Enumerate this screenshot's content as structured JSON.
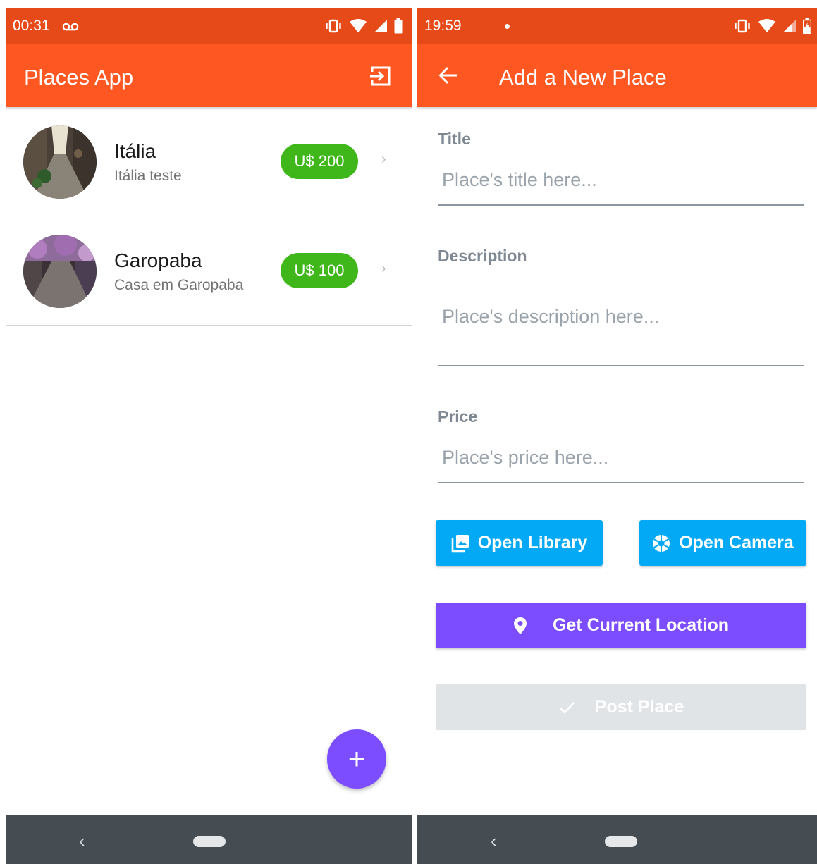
{
  "left_screen": {
    "status": {
      "time": "00:31"
    },
    "appbar": {
      "title": "Places App",
      "logout_icon": "logout-icon"
    },
    "places": [
      {
        "title": "Itália",
        "subtitle": "Itália teste",
        "price": "U$ 200"
      },
      {
        "title": "Garopaba",
        "subtitle": "Casa em Garopaba",
        "price": "U$ 100"
      }
    ],
    "fab": {
      "label": "+"
    },
    "colors": {
      "status": "#e64a19",
      "appbar": "#ff5722",
      "badge": "#3fb71a",
      "fab": "#7c4dff"
    }
  },
  "right_screen": {
    "status": {
      "time": "19:59"
    },
    "appbar": {
      "title": "Add a New Place",
      "back_icon": "arrow-left-icon"
    },
    "form": {
      "title_label": "Title",
      "title_placeholder": "Place's title here...",
      "description_label": "Description",
      "description_placeholder": "Place's description here...",
      "price_label": "Price",
      "price_placeholder": "Place's price here..."
    },
    "buttons": {
      "open_library": "Open Library",
      "open_camera": "Open Camera",
      "get_location": "Get Current Location",
      "post_place": "Post Place"
    },
    "colors": {
      "blue_button": "#03a9f4",
      "purple_button": "#7c4dff",
      "disabled_button": "#e1e4e7"
    }
  }
}
